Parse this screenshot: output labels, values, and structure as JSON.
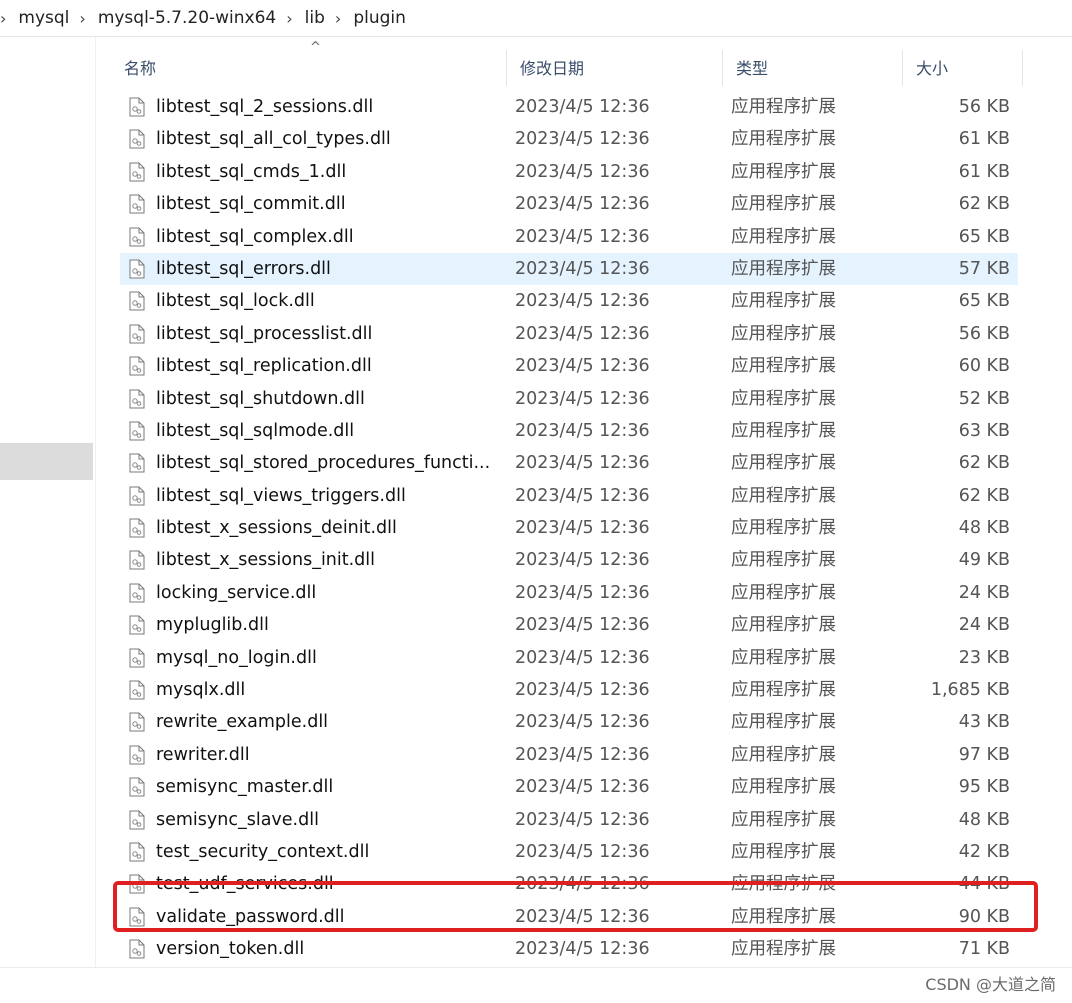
{
  "breadcrumb": [
    "mysql",
    "mysql-5.7.20-winx64",
    "lib",
    "plugin"
  ],
  "columns": {
    "name": "名称",
    "date": "修改日期",
    "type": "类型",
    "size": "大小"
  },
  "files": [
    {
      "name": "libtest_sql_2_sessions.dll",
      "date": "2023/4/5 12:36",
      "type": "应用程序扩展",
      "size": "56 KB"
    },
    {
      "name": "libtest_sql_all_col_types.dll",
      "date": "2023/4/5 12:36",
      "type": "应用程序扩展",
      "size": "61 KB"
    },
    {
      "name": "libtest_sql_cmds_1.dll",
      "date": "2023/4/5 12:36",
      "type": "应用程序扩展",
      "size": "61 KB"
    },
    {
      "name": "libtest_sql_commit.dll",
      "date": "2023/4/5 12:36",
      "type": "应用程序扩展",
      "size": "62 KB"
    },
    {
      "name": "libtest_sql_complex.dll",
      "date": "2023/4/5 12:36",
      "type": "应用程序扩展",
      "size": "65 KB"
    },
    {
      "name": "libtest_sql_errors.dll",
      "date": "2023/4/5 12:36",
      "type": "应用程序扩展",
      "size": "57 KB"
    },
    {
      "name": "libtest_sql_lock.dll",
      "date": "2023/4/5 12:36",
      "type": "应用程序扩展",
      "size": "65 KB"
    },
    {
      "name": "libtest_sql_processlist.dll",
      "date": "2023/4/5 12:36",
      "type": "应用程序扩展",
      "size": "56 KB"
    },
    {
      "name": "libtest_sql_replication.dll",
      "date": "2023/4/5 12:36",
      "type": "应用程序扩展",
      "size": "60 KB"
    },
    {
      "name": "libtest_sql_shutdown.dll",
      "date": "2023/4/5 12:36",
      "type": "应用程序扩展",
      "size": "52 KB"
    },
    {
      "name": "libtest_sql_sqlmode.dll",
      "date": "2023/4/5 12:36",
      "type": "应用程序扩展",
      "size": "63 KB"
    },
    {
      "name": "libtest_sql_stored_procedures_functi...",
      "date": "2023/4/5 12:36",
      "type": "应用程序扩展",
      "size": "62 KB"
    },
    {
      "name": "libtest_sql_views_triggers.dll",
      "date": "2023/4/5 12:36",
      "type": "应用程序扩展",
      "size": "62 KB"
    },
    {
      "name": "libtest_x_sessions_deinit.dll",
      "date": "2023/4/5 12:36",
      "type": "应用程序扩展",
      "size": "48 KB"
    },
    {
      "name": "libtest_x_sessions_init.dll",
      "date": "2023/4/5 12:36",
      "type": "应用程序扩展",
      "size": "49 KB"
    },
    {
      "name": "locking_service.dll",
      "date": "2023/4/5 12:36",
      "type": "应用程序扩展",
      "size": "24 KB"
    },
    {
      "name": "mypluglib.dll",
      "date": "2023/4/5 12:36",
      "type": "应用程序扩展",
      "size": "24 KB"
    },
    {
      "name": "mysql_no_login.dll",
      "date": "2023/4/5 12:36",
      "type": "应用程序扩展",
      "size": "23 KB"
    },
    {
      "name": "mysqlx.dll",
      "date": "2023/4/5 12:36",
      "type": "应用程序扩展",
      "size": "1,685 KB"
    },
    {
      "name": "rewrite_example.dll",
      "date": "2023/4/5 12:36",
      "type": "应用程序扩展",
      "size": "43 KB"
    },
    {
      "name": "rewriter.dll",
      "date": "2023/4/5 12:36",
      "type": "应用程序扩展",
      "size": "97 KB"
    },
    {
      "name": "semisync_master.dll",
      "date": "2023/4/5 12:36",
      "type": "应用程序扩展",
      "size": "95 KB"
    },
    {
      "name": "semisync_slave.dll",
      "date": "2023/4/5 12:36",
      "type": "应用程序扩展",
      "size": "48 KB"
    },
    {
      "name": "test_security_context.dll",
      "date": "2023/4/5 12:36",
      "type": "应用程序扩展",
      "size": "42 KB"
    },
    {
      "name": "test_udf_services.dll",
      "date": "2023/4/5 12:36",
      "type": "应用程序扩展",
      "size": "44 KB"
    },
    {
      "name": "validate_password.dll",
      "date": "2023/4/5 12:36",
      "type": "应用程序扩展",
      "size": "90 KB"
    },
    {
      "name": "version_token.dll",
      "date": "2023/4/5 12:36",
      "type": "应用程序扩展",
      "size": "71 KB"
    }
  ],
  "hover_row": "libtest_sql_errors.dll",
  "highlighted_file": "validate_password.dll",
  "watermark": "CSDN @大道之简",
  "colors": {
    "hover": "#e5f3ff",
    "highlight_border": "#e02020",
    "header_text": "#3a4e6b"
  }
}
